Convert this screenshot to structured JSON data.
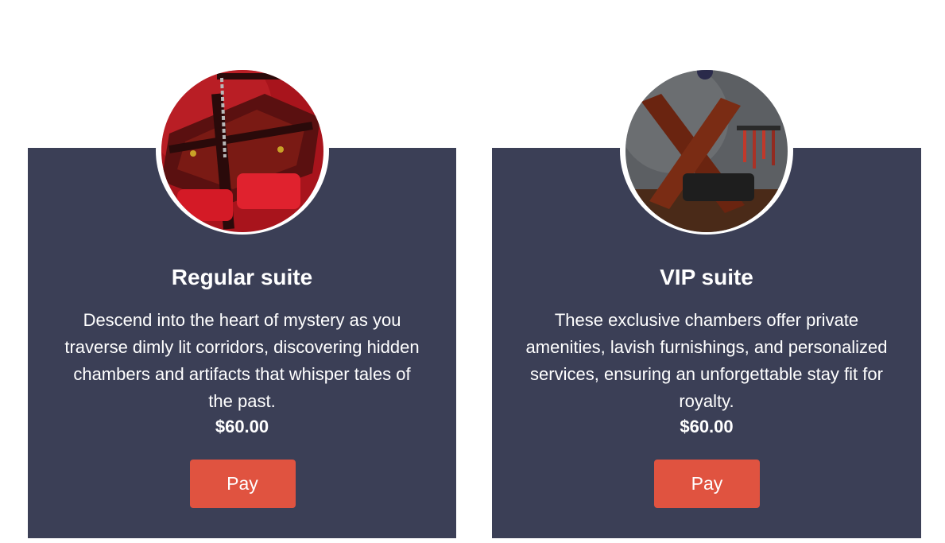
{
  "colors": {
    "card_background": "#3b3f56",
    "button": "#e05340",
    "text": "#ffffff"
  },
  "cards": [
    {
      "title": "Regular suite",
      "description": "Descend into the heart of mystery as you traverse dimly lit corridors, discovering hidden chambers and artifacts that whisper tales of the past.",
      "price": "$60.00",
      "button_label": "Pay"
    },
    {
      "title": "VIP suite",
      "description": "These exclusive chambers offer private amenities, lavish furnishings, and personalized services, ensuring an unforgettable stay fit for royalty.",
      "price": "$60.00",
      "button_label": "Pay"
    }
  ]
}
